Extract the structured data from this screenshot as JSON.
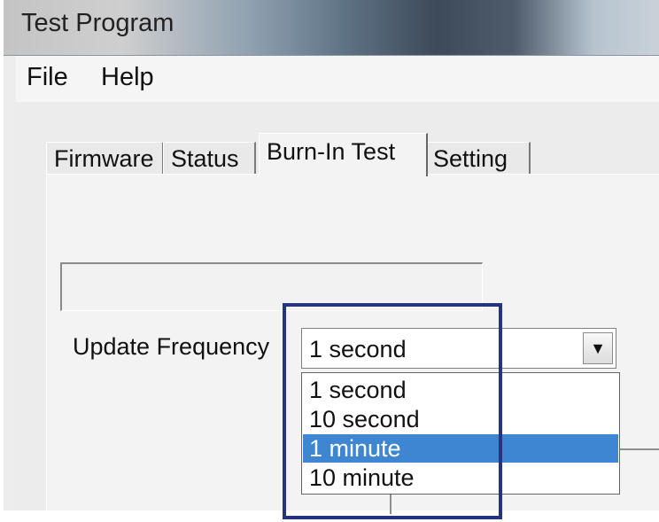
{
  "window": {
    "title": "Test Program"
  },
  "menu": {
    "file": "File",
    "help": "Help"
  },
  "tabs": [
    {
      "label": "Firmware"
    },
    {
      "label": "Status"
    },
    {
      "label": "Burn-In Test"
    },
    {
      "label": "Setting"
    }
  ],
  "active_tab": "Burn-In Test",
  "form": {
    "update_frequency_label": "Update Frequency",
    "update_frequency_value": "1 second",
    "options": [
      "1 second",
      "10 second",
      "1 minute",
      "10 minute"
    ],
    "highlighted_option": "1 minute"
  },
  "colors": {
    "selection": "#3f86d1",
    "annotation_box": "#25347f"
  },
  "icons": {
    "dropdown_arrow": "chevron-down-icon"
  }
}
